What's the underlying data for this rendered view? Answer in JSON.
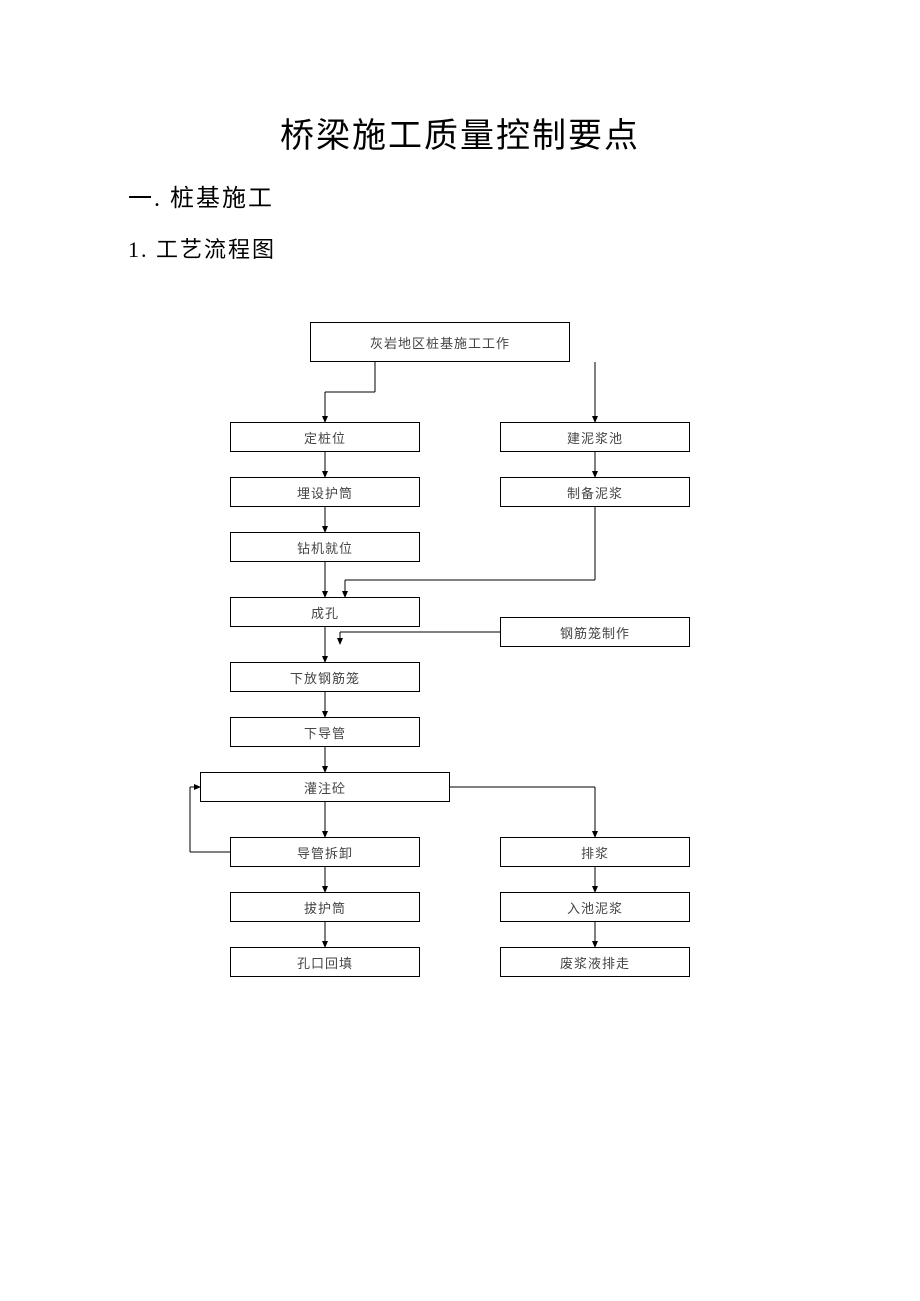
{
  "title": "桥梁施工质量控制要点",
  "section1": "一. 桩基施工",
  "subsection1": "1. 工艺流程图",
  "chart_data": {
    "type": "flowchart",
    "nodes": [
      {
        "id": "n0",
        "label": "灰岩地区桩基施工工作",
        "col": "center",
        "row": 0
      },
      {
        "id": "n1",
        "label": "定桩位",
        "col": "left",
        "row": 1
      },
      {
        "id": "n2",
        "label": "建泥浆池",
        "col": "right",
        "row": 1
      },
      {
        "id": "n3",
        "label": "埋设护筒",
        "col": "left",
        "row": 2
      },
      {
        "id": "n4",
        "label": "制备泥浆",
        "col": "right",
        "row": 2
      },
      {
        "id": "n5",
        "label": "钻机就位",
        "col": "left",
        "row": 3
      },
      {
        "id": "n6",
        "label": "成孔",
        "col": "left",
        "row": 4
      },
      {
        "id": "n7",
        "label": "钢筋笼制作",
        "col": "right",
        "row": 4
      },
      {
        "id": "n8",
        "label": "下放钢筋笼",
        "col": "left",
        "row": 5
      },
      {
        "id": "n9",
        "label": "下导管",
        "col": "left",
        "row": 6
      },
      {
        "id": "n10",
        "label": "灌注砼",
        "col": "left",
        "row": 7
      },
      {
        "id": "n11",
        "label": "导管拆卸",
        "col": "left",
        "row": 8
      },
      {
        "id": "n12",
        "label": "排浆",
        "col": "right",
        "row": 8
      },
      {
        "id": "n13",
        "label": "拔护筒",
        "col": "left",
        "row": 9
      },
      {
        "id": "n14",
        "label": "入池泥浆",
        "col": "right",
        "row": 9
      },
      {
        "id": "n15",
        "label": "孔口回填",
        "col": "left",
        "row": 10
      },
      {
        "id": "n16",
        "label": "废浆液排走",
        "col": "right",
        "row": 10
      }
    ],
    "edges": [
      {
        "from": "n0",
        "to": "n1"
      },
      {
        "from": "n0",
        "to": "n2"
      },
      {
        "from": "n1",
        "to": "n3"
      },
      {
        "from": "n2",
        "to": "n4"
      },
      {
        "from": "n3",
        "to": "n5"
      },
      {
        "from": "n5",
        "to": "n6"
      },
      {
        "from": "n4",
        "to": "n6"
      },
      {
        "from": "n6",
        "to": "n8"
      },
      {
        "from": "n7",
        "to": "n8",
        "note": "into-side-of-n6-n8-link"
      },
      {
        "from": "n8",
        "to": "n9"
      },
      {
        "from": "n9",
        "to": "n10"
      },
      {
        "from": "n10",
        "to": "n11"
      },
      {
        "from": "n10",
        "to": "n12"
      },
      {
        "from": "n11",
        "to": "n13"
      },
      {
        "from": "n12",
        "to": "n14"
      },
      {
        "from": "n13",
        "to": "n15"
      },
      {
        "from": "n14",
        "to": "n16"
      },
      {
        "from": "n11",
        "to": "n10",
        "note": "feedback-loop-left"
      }
    ]
  }
}
